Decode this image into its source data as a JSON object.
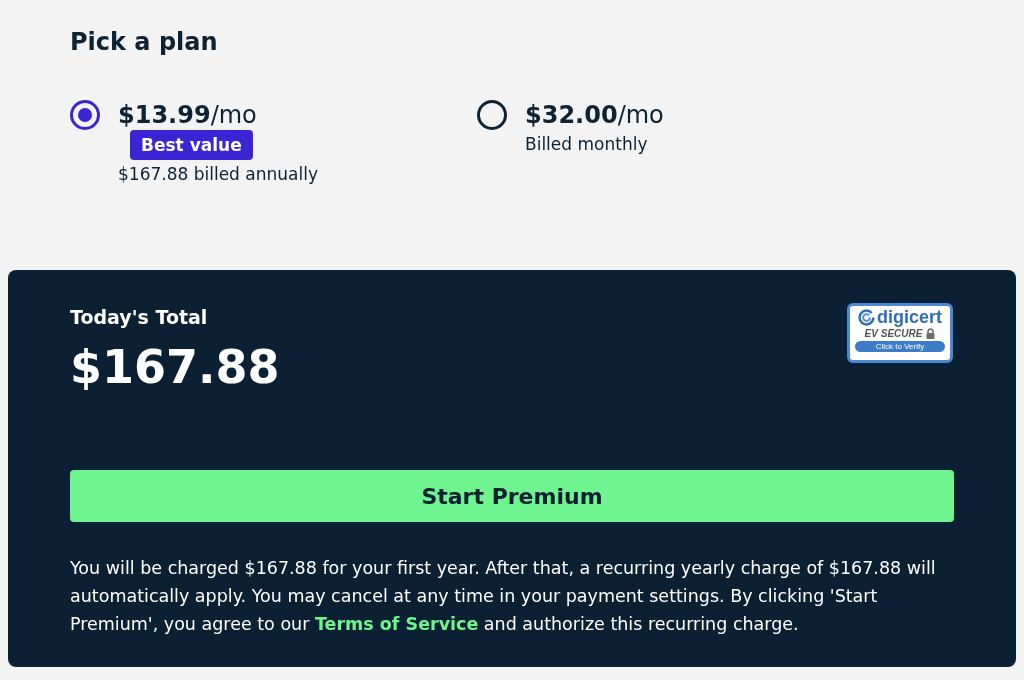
{
  "heading": "Pick a plan",
  "plans": [
    {
      "price": "**$13.99**/mo",
      "badge": "Best value",
      "note": "$167.88 billed annually",
      "selected": true
    },
    {
      "price": "**$32.00**/mo",
      "note": "Billed monthly",
      "selected": false
    }
  ],
  "summary": {
    "label": "Today's Total",
    "amount": "$167.88",
    "seal": {
      "brand": "digicert",
      "line": "EV SECURE",
      "action": "Click to Verify"
    }
  },
  "cta": {
    "label": "Start Premium"
  },
  "disclaimer": {
    "before": "You will be charged $167.88 for your first year. After that, a recurring yearly charge of $167.88 will automatically apply. You may cancel at any time in your payment settings. By clicking 'Start Premium', you agree to our ",
    "link": "Terms of Service",
    "after": " and authorize this recurring charge."
  }
}
